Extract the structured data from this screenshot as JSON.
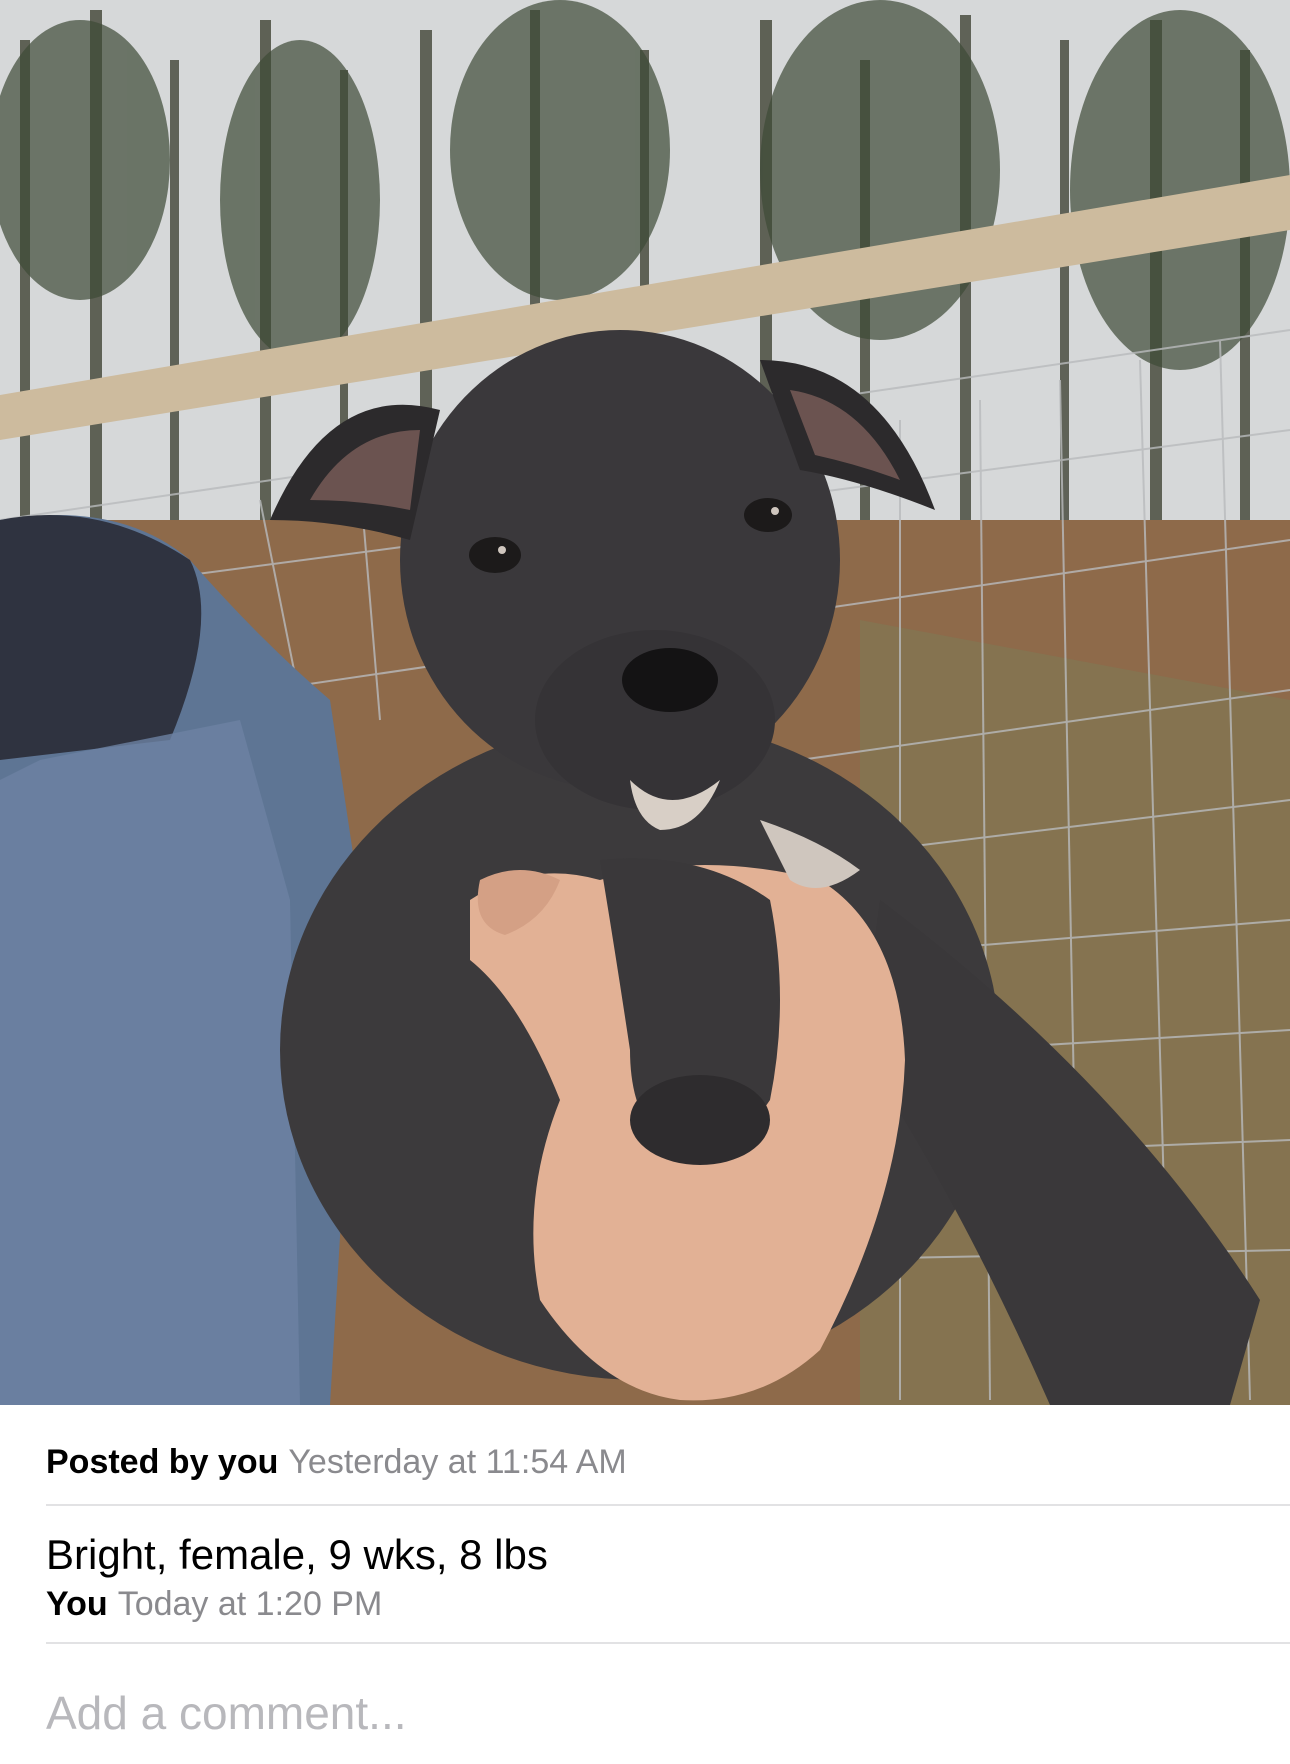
{
  "photo": {
    "subject": "puppy-photo"
  },
  "post": {
    "posted_by_label": "Posted by you",
    "posted_time": "Yesterday at 11:54 AM"
  },
  "comment": {
    "text": "Bright, female, 9 wks, 8 lbs",
    "author": "You",
    "time": "Today at 1:20 PM"
  },
  "composer": {
    "placeholder": "Add a comment..."
  },
  "colors": {
    "secondary_text": "#8a8a8e",
    "placeholder": "#b8b8bc",
    "divider": "#e2e2e4"
  }
}
